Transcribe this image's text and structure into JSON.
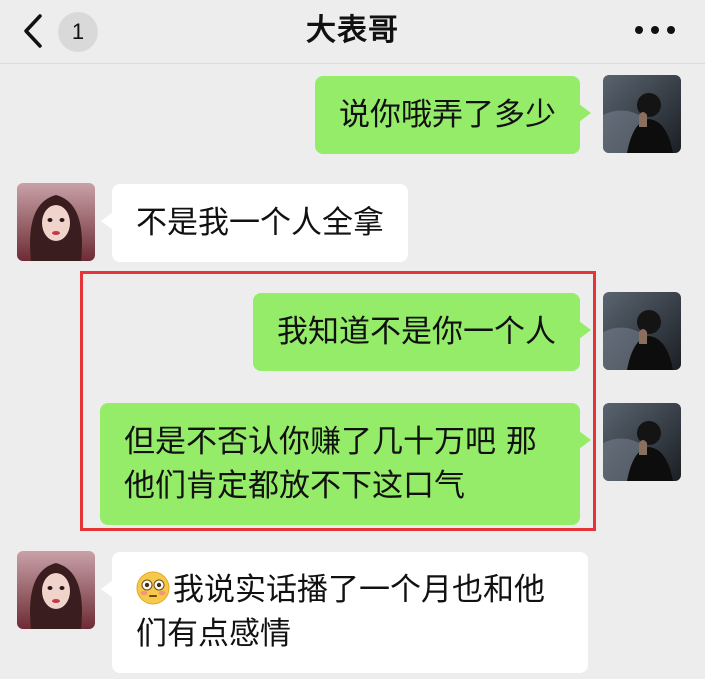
{
  "header": {
    "title": "大表哥",
    "unread_count": "1"
  },
  "messages": [
    {
      "side": "sent",
      "text": "说你哦弄了多少"
    },
    {
      "side": "received",
      "text": "不是我一个人全拿"
    },
    {
      "side": "sent",
      "text": "我知道不是你一个人"
    },
    {
      "side": "sent",
      "line1": "但是不否认你赚了几十万吧 那",
      "line2": "他们肯定都放不下这口气"
    },
    {
      "side": "received",
      "emoji": "flushed-face",
      "line1": "我说实话播了一个月也和他",
      "line2": "们有点感情"
    }
  ],
  "highlight_color": "#e5353a",
  "colors": {
    "sent_bubble": "#95ec69",
    "received_bubble": "#ffffff",
    "background": "#ededed"
  },
  "icons": [
    "back-chevron-icon",
    "more-dots-icon",
    "flushed-face-emoji-icon"
  ]
}
